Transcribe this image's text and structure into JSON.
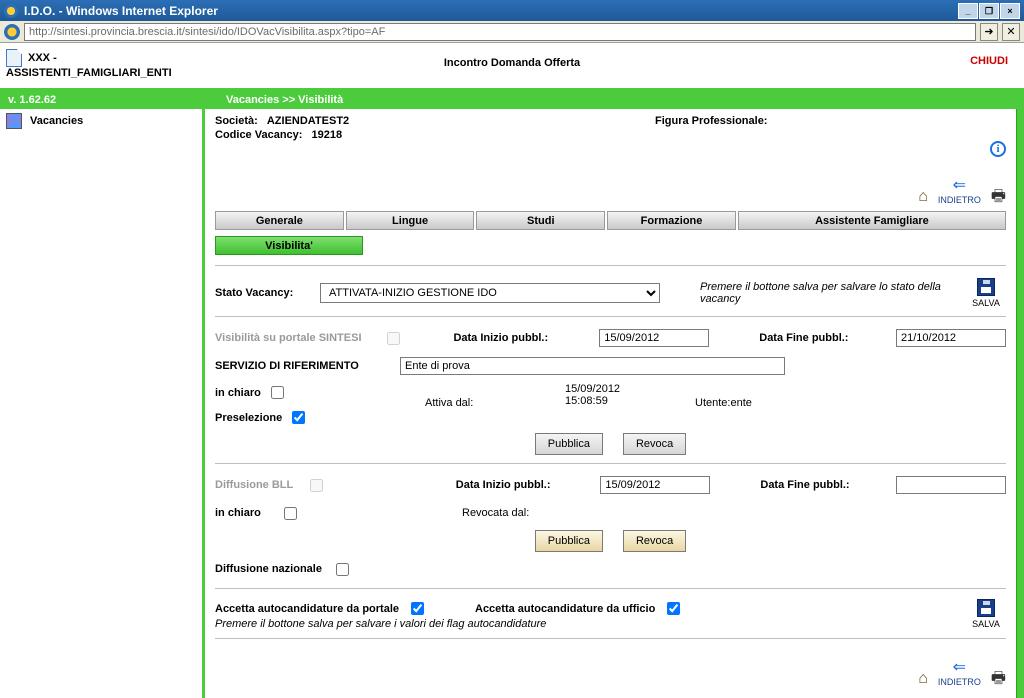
{
  "window": {
    "title": "I.D.O. - Windows Internet Explorer",
    "url": "http://sintesi.provincia.brescia.it/sintesi/ido/IDOVacVisibilita.aspx?tipo=AF",
    "btn_min": "_",
    "btn_restore": "❐",
    "btn_close": "×"
  },
  "header": {
    "user_top": "XXX -",
    "user_bottom": "ASSISTENTI_FAMIGLIARI_ENTI",
    "title": "Incontro Domanda Offerta",
    "close": "CHIUDI",
    "version": "v. 1.62.62",
    "breadcrumb": "Vacancies >> Visibilità"
  },
  "sidebar": {
    "vacancies": "Vacancies"
  },
  "info": {
    "societa_label": "Società:",
    "societa_value": "AZIENDATEST2",
    "codice_label": "Codice Vacancy:",
    "codice_value": "19218",
    "figura_label": "Figura Professionale:"
  },
  "icons": {
    "indietro": "INDIETRO"
  },
  "tabs": {
    "generale": "Generale",
    "lingue": "Lingue",
    "studi": "Studi",
    "formazione": "Formazione",
    "assistente": "Assistente Famigliare",
    "visibilita": "Visibilita'"
  },
  "form": {
    "stato_label": "Stato Vacancy:",
    "stato_value": "ATTIVATA-INIZIO GESTIONE IDO",
    "stato_help": "Premere il bottone salva per salvare lo stato della vacancy",
    "salva": "SALVA",
    "vis_sintesi": "Visibilità su portale SINTESI",
    "data_inizio_label": "Data Inizio pubbl.:",
    "data_inizio_1": "15/09/2012",
    "data_fine_label": "Data Fine pubbl.:",
    "data_fine_1": "21/10/2012",
    "servizio_label": "SERVIZIO DI RIFERIMENTO",
    "servizio_value": "Ente di prova",
    "in_chiaro": "in chiaro",
    "preselezione": "Preselezione",
    "attiva_dal": "Attiva dal:",
    "attiva_dt1": "15/09/2012",
    "attiva_dt2": "15:08:59",
    "utente_label": "Utente:",
    "utente_value": "ente",
    "pubblica": "Pubblica",
    "revoca": "Revoca",
    "diff_bll": "Diffusione BLL",
    "data_inizio_2": "15/09/2012",
    "data_fine_2": "",
    "revocata_dal": "Revocata dal:",
    "diff_naz": "Diffusione nazionale",
    "accetta_portale": "Accetta autocandidature da portale",
    "accetta_ufficio": "Accetta autocandidature da ufficio",
    "flags_help": "Premere il bottone salva  per salvare i valori dei flag autocandidature"
  }
}
